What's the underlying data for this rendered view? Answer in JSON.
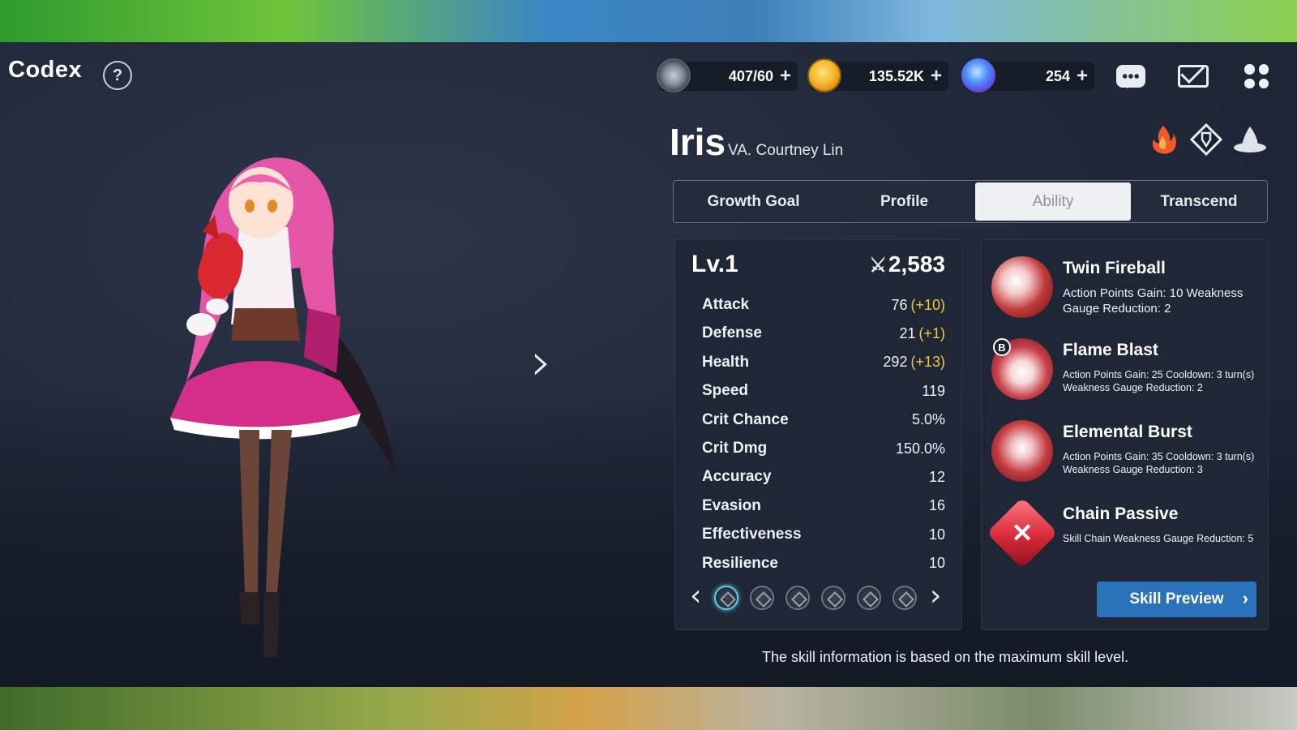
{
  "header": {
    "title": "Codex",
    "help_icon": "question-circle-icon",
    "resources": [
      {
        "icon": "stamina-icon",
        "value": "407/60"
      },
      {
        "icon": "gold-coin-icon",
        "value": "135.52K"
      },
      {
        "icon": "crystal-gem-icon",
        "value": "254"
      }
    ],
    "plus": "+",
    "buttons": [
      "chat-icon",
      "mail-icon",
      "menu-grid-icon"
    ]
  },
  "character": {
    "name": "Iris",
    "voice_actor": "VA. Courtney Lin",
    "class_icons": [
      "fire-element-icon",
      "class-diamond-icon",
      "witch-hat-icon"
    ],
    "next_glyph": "›"
  },
  "tabs": [
    {
      "label": "Growth Goal",
      "active": false
    },
    {
      "label": "Profile",
      "active": false
    },
    {
      "label": "Ability",
      "active": true
    },
    {
      "label": "Transcend",
      "active": false
    }
  ],
  "stats": {
    "level": "Lv.1",
    "power_icon": "crossed-swords-icon",
    "power": "2,583",
    "rows": [
      {
        "name": "Attack",
        "value": "76",
        "bonus": "(+10)"
      },
      {
        "name": "Defense",
        "value": "21",
        "bonus": "(+1)"
      },
      {
        "name": "Health",
        "value": "292",
        "bonus": "(+13)"
      },
      {
        "name": "Speed",
        "value": "119",
        "bonus": ""
      },
      {
        "name": "Crit Chance",
        "value": "5.0%",
        "bonus": ""
      },
      {
        "name": "Crit Dmg",
        "value": "150.0%",
        "bonus": ""
      },
      {
        "name": "Accuracy",
        "value": "12",
        "bonus": ""
      },
      {
        "name": "Evasion",
        "value": "16",
        "bonus": ""
      },
      {
        "name": "Effectiveness",
        "value": "10",
        "bonus": ""
      },
      {
        "name": "Resilience",
        "value": "10",
        "bonus": ""
      }
    ],
    "pages": 6,
    "active_page": 1,
    "prev_glyph": "‹",
    "next_glyph": "›"
  },
  "skills": [
    {
      "name": "Twin Fireball",
      "badge": "",
      "description": "Action Points Gain: 10 Weakness Gauge Reduction: 2",
      "icon": "twin-fireball-icon"
    },
    {
      "name": "Flame Blast",
      "badge": "B",
      "description": "Action Points Gain: 25 Cooldown: 3 turn(s) Weakness Gauge Reduction: 2",
      "icon": "flame-blast-icon"
    },
    {
      "name": "Elemental Burst",
      "badge": "",
      "description": "Action Points Gain: 35 Cooldown: 3 turn(s) Weakness Gauge Reduction: 3",
      "icon": "elemental-burst-icon"
    },
    {
      "name": "Chain Passive",
      "badge": "",
      "description": "Skill Chain Weakness Gauge Reduction: 5",
      "icon": "chain-passive-icon"
    }
  ],
  "skill_preview": {
    "label": "Skill Preview",
    "chevron": "›"
  },
  "footnote": "The skill information is based on the maximum skill level.",
  "colors": {
    "accent_blue": "#2a72b9",
    "bonus_yellow": "#f4c542",
    "panel": "#1f2736"
  }
}
